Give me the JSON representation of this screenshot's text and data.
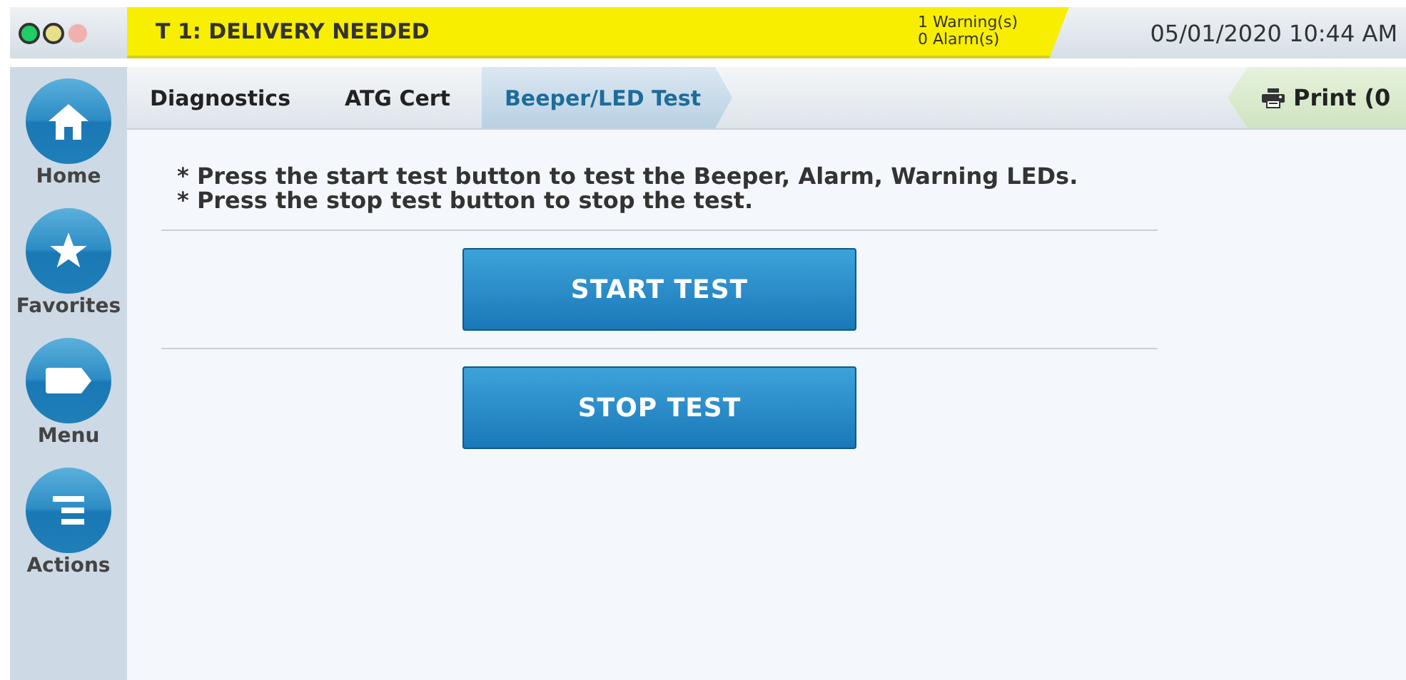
{
  "status_lights": [
    {
      "color": "#22cc66",
      "on": true
    },
    {
      "color": "#e6e08a",
      "on": true
    },
    {
      "color": "#f0b0b0",
      "on": false
    }
  ],
  "alert_banner": {
    "message": "T 1: DELIVERY NEEDED",
    "warnings": "1 Warning(s)",
    "alarms": "0 Alarm(s)"
  },
  "clock": "05/01/2020 10:44 AM",
  "sidebar": {
    "items": [
      {
        "kind": "home",
        "label": "Home"
      },
      {
        "kind": "star",
        "label": "Favorites"
      },
      {
        "kind": "menu",
        "label": "Menu"
      },
      {
        "kind": "actions",
        "label": "Actions"
      }
    ]
  },
  "breadcrumbs": [
    {
      "label": "Diagnostics",
      "selected": false
    },
    {
      "label": "ATG Cert",
      "selected": false
    },
    {
      "label": "Beeper/LED Test",
      "selected": true
    }
  ],
  "print_button": "Print (0",
  "instructions": [
    "* Press the start test button to test the Beeper, Alarm, Warning LEDs.",
    "* Press the stop test button to stop the test."
  ],
  "buttons": [
    "START TEST",
    "STOP TEST"
  ]
}
